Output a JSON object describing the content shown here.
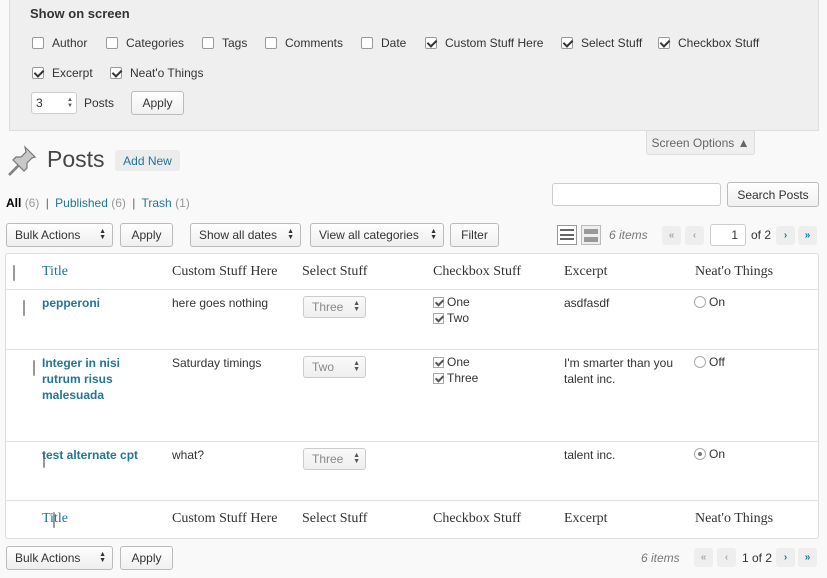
{
  "screen_options": {
    "title": "Show on screen",
    "columns": [
      {
        "label": "Author",
        "checked": false
      },
      {
        "label": "Categories",
        "checked": false
      },
      {
        "label": "Tags",
        "checked": false
      },
      {
        "label": "Comments",
        "checked": false
      },
      {
        "label": "Date",
        "checked": false
      },
      {
        "label": "Custom Stuff Here",
        "checked": true
      },
      {
        "label": "Select Stuff",
        "checked": true
      },
      {
        "label": "Checkbox Stuff",
        "checked": true
      },
      {
        "label": "Excerpt",
        "checked": true
      },
      {
        "label": "Neat'o Things",
        "checked": true
      }
    ],
    "per_page_value": "3",
    "per_page_label": "Posts",
    "apply_label": "Apply",
    "tab_label": "Screen Options ▲"
  },
  "header": {
    "title": "Posts",
    "add_new": "Add New"
  },
  "views": {
    "all": "All",
    "all_count": "(6)",
    "published": "Published",
    "published_count": "(6)",
    "trash": "Trash",
    "trash_count": "(1)",
    "sep": "|"
  },
  "search": {
    "button": "Search Posts"
  },
  "tablenav_top": {
    "bulk_actions": "Bulk Actions",
    "apply": "Apply",
    "dates": "Show all dates",
    "categories": "View all categories",
    "filter": "Filter",
    "items": "6 items",
    "first": "«",
    "prev": "‹",
    "page": "1",
    "of": "of 2",
    "next": "›",
    "last": "»"
  },
  "table": {
    "headers": [
      "Title",
      "Custom Stuff Here",
      "Select Stuff",
      "Checkbox Stuff",
      "Excerpt",
      "Neat'o Things"
    ],
    "rows": [
      {
        "title": "pepperoni",
        "custom": "here goes nothing",
        "select": "Three",
        "checks": [
          "One",
          "Two"
        ],
        "excerpt": "asdfasdf",
        "neato": "On",
        "neato_checked": false
      },
      {
        "title": "Integer in nisi rutrum risus malesuada",
        "custom": "Saturday timings",
        "select": "Two",
        "checks": [
          "One",
          "Three"
        ],
        "excerpt": "I'm smarter than you talent inc.",
        "neato": "Off",
        "neato_checked": false
      },
      {
        "title": "test alternate cpt",
        "custom": "what?",
        "select": "Three",
        "checks": [],
        "excerpt": "talent inc.",
        "neato": "On",
        "neato_checked": true
      }
    ]
  },
  "tablenav_bottom": {
    "bulk_actions": "Bulk Actions",
    "apply": "Apply",
    "items": "6 items",
    "first": "«",
    "prev": "‹",
    "page_text": "1 of 2",
    "next": "›",
    "last": "»"
  },
  "colors": {
    "link": "#21759b",
    "panel_bg": "#efefef"
  }
}
